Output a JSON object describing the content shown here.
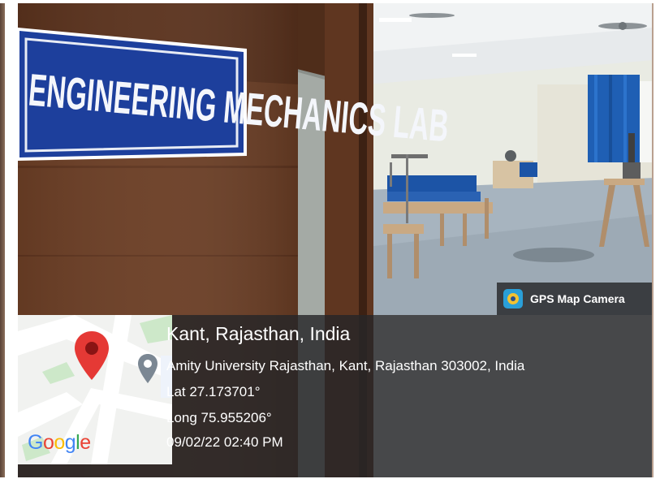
{
  "photo": {
    "sign_text": "ENGINEERING MECHANICS LAB",
    "colors": {
      "sign_blue": "#1d3f9c",
      "door_brown": "#6b3e25",
      "curtain_blue": "#1f5fb4",
      "floor_gray": "#a7b4bf",
      "overlay": "#262628"
    }
  },
  "badge": {
    "label": "GPS Map Camera",
    "icon": "gps-map-camera-icon"
  },
  "map": {
    "logo": "Google",
    "pin_icon": "map-pin-icon",
    "poi_icon": "place-marker-icon"
  },
  "location": {
    "title": "Kant, Rajasthan, India",
    "address": "Amity University Rajasthan, Kant, Rajasthan 303002, India",
    "lat": "Lat 27.173701°",
    "long": "Long 75.955206°",
    "datetime": "09/02/22 02:40 PM"
  }
}
